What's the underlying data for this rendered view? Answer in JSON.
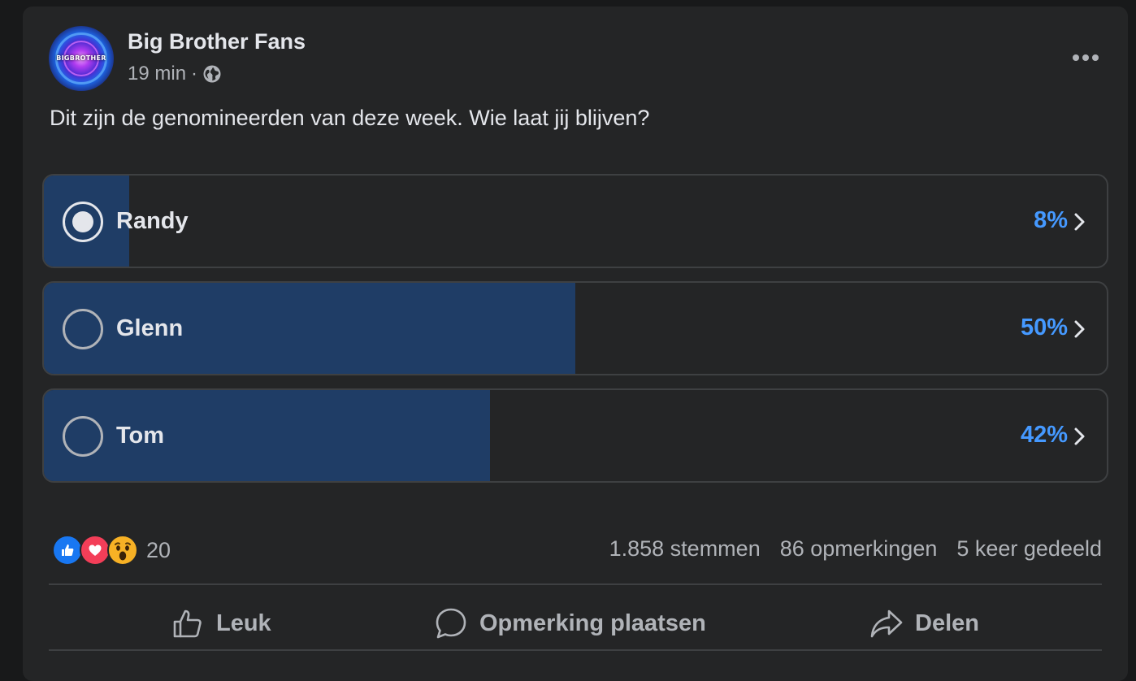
{
  "post": {
    "page_name": "Big Brother Fans",
    "avatar_logo_text": "BIGBROTHER",
    "time": "19 min",
    "separator": "·",
    "privacy_icon": "globe-icon",
    "more_icon": "more-options-icon",
    "text": "Dit zijn de genomineerden van deze week. Wie laat jij blijven?"
  },
  "poll": {
    "options": [
      {
        "label": "Randy",
        "percent_text": "8%",
        "fraction": 0.08,
        "selected": true
      },
      {
        "label": "Glenn",
        "percent_text": "50%",
        "fraction": 0.5,
        "selected": false
      },
      {
        "label": "Tom",
        "percent_text": "42%",
        "fraction": 0.42,
        "selected": false
      }
    ]
  },
  "engagement": {
    "reaction_icons": [
      "like-icon",
      "love-icon",
      "wow-icon"
    ],
    "reaction_count": "20",
    "votes": "1.858 stemmen",
    "comments": "86 opmerkingen",
    "shares": "5 keer gedeeld"
  },
  "actions": {
    "like_label": "Leuk",
    "comment_label": "Opmerking plaatsen",
    "share_label": "Delen"
  },
  "colors": {
    "background": "#18191a",
    "card": "#242526",
    "poll_fill": "#1f3d66",
    "percent_accent": "#4599ff",
    "text_primary": "#e4e6eb",
    "text_secondary": "#b0b3b8"
  }
}
